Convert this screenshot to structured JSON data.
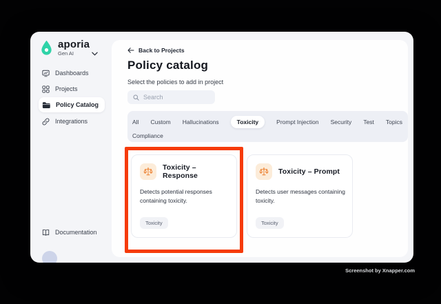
{
  "colors": {
    "accent_teal": "#2fd3a8",
    "highlight_red": "#f63b09",
    "icon_orange": "#ec7f2e",
    "icon_orange_bg": "#fcecd9"
  },
  "sidebar": {
    "brand": "aporia",
    "workspace": "Gen AI",
    "items": [
      {
        "label": "Dashboards",
        "active": false
      },
      {
        "label": "Projects",
        "active": false
      },
      {
        "label": "Policy Catalog",
        "active": true
      },
      {
        "label": "Integrations",
        "active": false
      }
    ],
    "footer": {
      "label": "Documentation"
    }
  },
  "main": {
    "back_link": "Back to Projects",
    "title": "Policy catalog",
    "subtitle": "Select the policies to add in project",
    "search_placeholder": "Search",
    "tabs": {
      "active": "Toxicity",
      "row1": [
        "All",
        "Custom",
        "Hallucinations",
        "Toxicity",
        "Prompt Injection",
        "Security",
        "Test",
        "Topics"
      ],
      "row2": [
        "Compliance"
      ]
    },
    "cards": [
      {
        "title": "Toxicity – Response",
        "description": "Detects potential responses containing toxicity.",
        "tag": "Toxicity",
        "highlighted": true
      },
      {
        "title": "Toxicity – Prompt",
        "description": "Detects user messages containing toxicity.",
        "tag": "Toxicity",
        "highlighted": false
      }
    ]
  },
  "watermark": "Screenshot by Xnapper.com"
}
